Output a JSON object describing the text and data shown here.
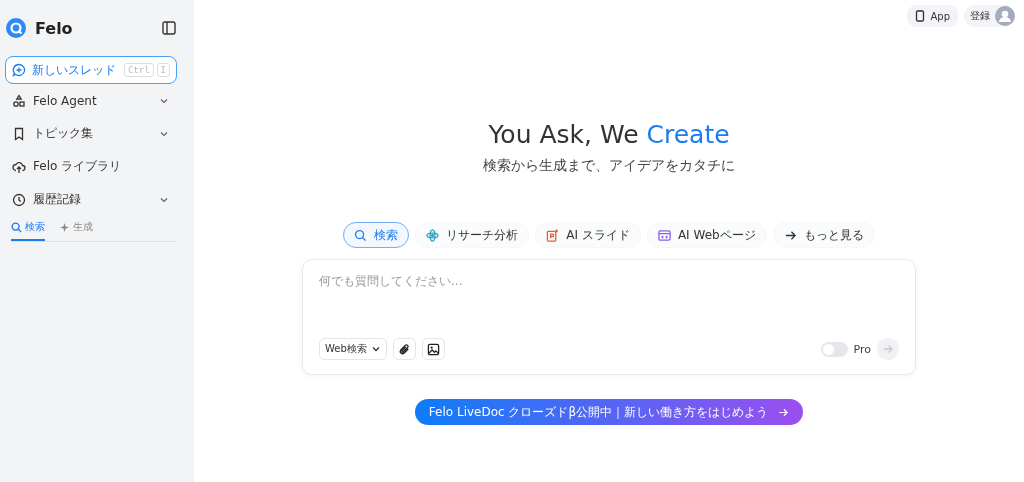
{
  "sidebar": {
    "logo": "Felo",
    "new_thread": {
      "label": "新しいスレッド",
      "keys": [
        "Ctrl",
        "I"
      ]
    },
    "items": [
      {
        "kind": "agent",
        "label": "Felo Agent",
        "expandable": true
      },
      {
        "kind": "topic",
        "label": "トピック集",
        "expandable": true
      },
      {
        "kind": "library",
        "label": "Felo ライブラリ",
        "expandable": false
      },
      {
        "kind": "history",
        "label": "履歴記録",
        "expandable": true
      }
    ],
    "tabs": [
      {
        "kind": "search",
        "label": "検索",
        "selected": true
      },
      {
        "kind": "generate",
        "label": "生成",
        "selected": false
      }
    ]
  },
  "header": {
    "app": "App",
    "login": "登録"
  },
  "hero": {
    "title": "You Ask, We",
    "title_highlight": "Create",
    "subtitle": "検索から生成まで、アイデアをカタチに"
  },
  "modes": [
    {
      "kind": "search",
      "label": "検索",
      "selected": true
    },
    {
      "kind": "research",
      "label": "リサーチ分析",
      "selected": false
    },
    {
      "kind": "slide",
      "label": "AI スライド",
      "selected": false
    },
    {
      "kind": "web",
      "label": "AI Webページ",
      "selected": false
    },
    {
      "kind": "more",
      "label": "もっと見る",
      "selected": false
    }
  ],
  "composer": {
    "placeholder": "何でも質問してください...",
    "source": "Web検索",
    "pro": {
      "label": "Pro",
      "on": false
    }
  },
  "banner": {
    "text": "Felo LiveDoc クローズドβ公開中｜新しい働き方をはじめよう"
  }
}
